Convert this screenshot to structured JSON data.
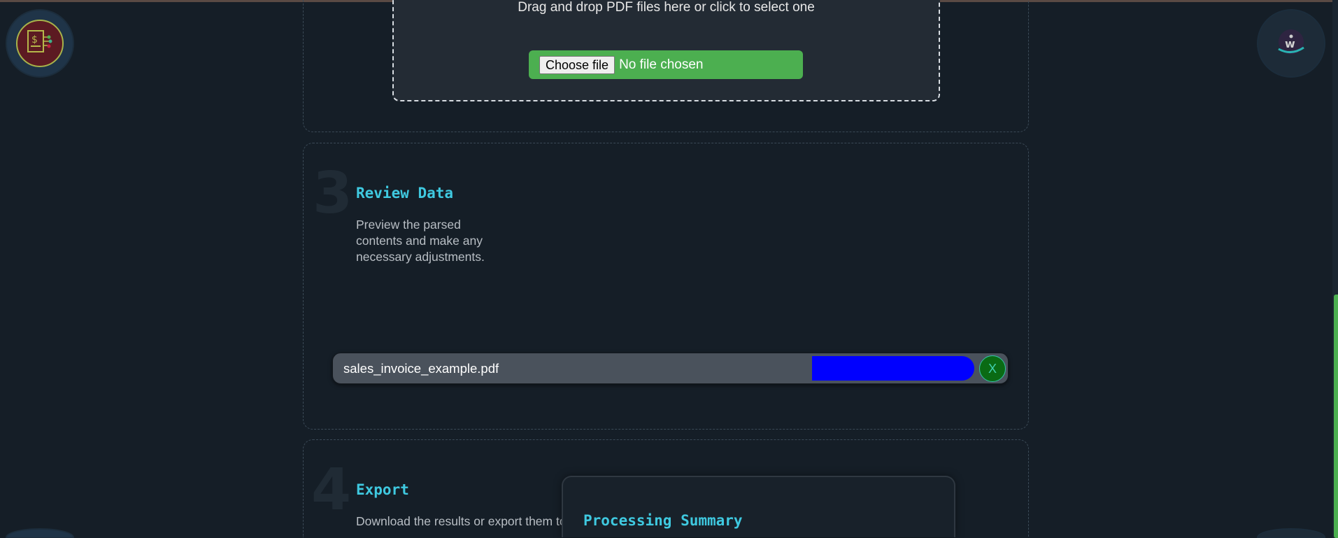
{
  "upload": {
    "drop_text": "Drag and drop PDF files here or click to select one",
    "choose_file_label": "Choose file",
    "no_file_text": "No file chosen"
  },
  "steps": [
    {
      "number": "3",
      "title": "Review Data",
      "description": "Preview the parsed contents and make any necessary adjustments."
    },
    {
      "number": "4",
      "title": "Export",
      "description": "Download the results or export them to your"
    }
  ],
  "file_item": {
    "name": "sales_invoice_example.pdf",
    "remove_label": "X",
    "progress_percent": 100,
    "progress_color": "#0000ff"
  },
  "summary": {
    "title": "Processing Summary"
  },
  "colors": {
    "accent": "#3fc9e0",
    "success": "#4caf50",
    "background": "#151e27"
  }
}
